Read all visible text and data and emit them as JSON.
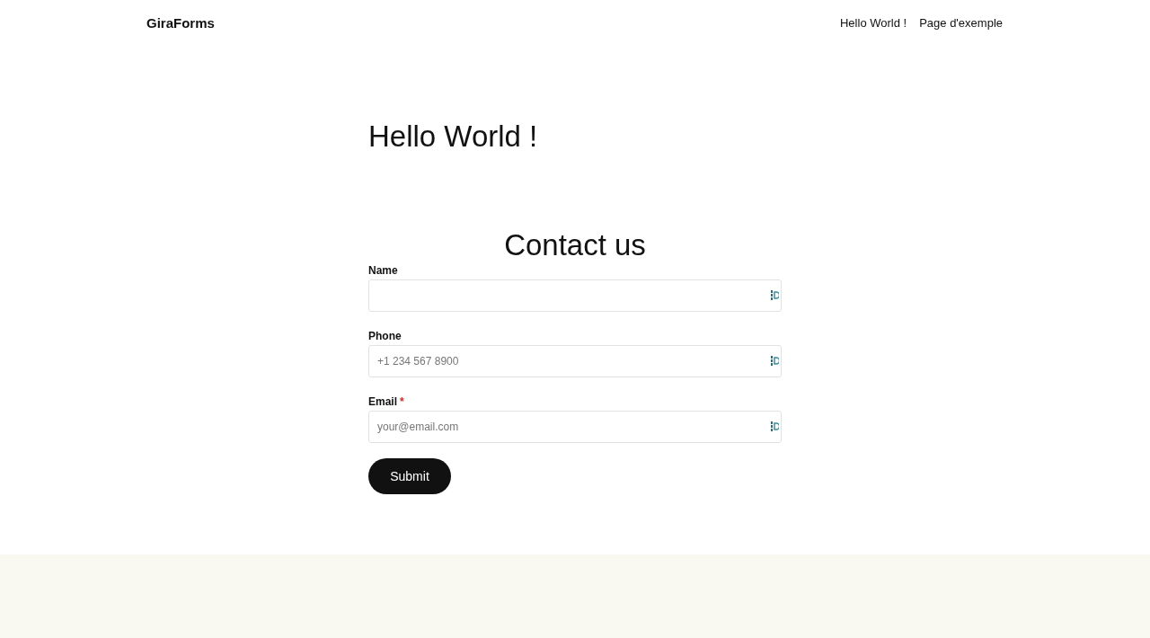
{
  "header": {
    "logo": "GiraForms",
    "nav": [
      "Hello World !",
      "Page d'exemple"
    ]
  },
  "page_title": "Hello World !",
  "form": {
    "title": "Contact us",
    "fields": [
      {
        "label": "Name"
      },
      {
        "label": "Phone",
        "placeholder": "+1 234 567 8900"
      },
      {
        "label": "Email",
        "mark": "*",
        "placeholder": "your@email.com"
      }
    ],
    "submit": "Submit"
  }
}
